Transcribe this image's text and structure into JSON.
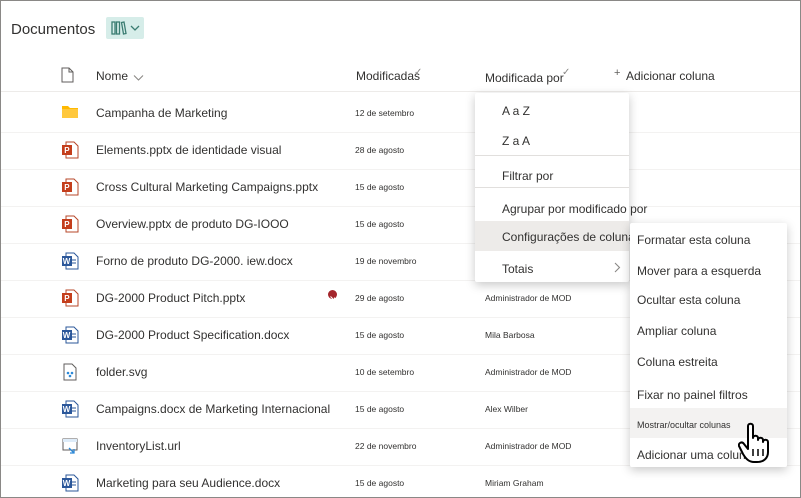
{
  "header": {
    "title": "Documentos"
  },
  "columns": {
    "name": "Nome",
    "modified": "Modificadas",
    "modified_by": "Modificada por",
    "add_column": "Adicionar coluna"
  },
  "files": [
    {
      "type": "folder",
      "icon": "folder-icon",
      "name": "Campanha de Marketing",
      "date": "12 de setembro",
      "by": ""
    },
    {
      "type": "pptx",
      "icon": "powerpoint-icon",
      "name": "Elements.pptx de identidade visual",
      "date": "28 de agosto",
      "by": ""
    },
    {
      "type": "pptx",
      "icon": "powerpoint-icon",
      "name": "Cross Cultural Marketing Campaigns.pptx",
      "date": "15 de agosto",
      "by": ""
    },
    {
      "type": "pptx",
      "icon": "powerpoint-icon",
      "name": "Overview.pptx de produto DG-IOOO",
      "date": "15 de agosto",
      "by": ""
    },
    {
      "type": "docx",
      "icon": "word-icon",
      "name": "Forno de produto DG-2000. iew.docx",
      "date": "19 de novembro",
      "by": ""
    },
    {
      "type": "pptx",
      "icon": "powerpoint-icon",
      "name": "DG-2000 Product Pitch.pptx",
      "date": "29 de agosto",
      "by": "Administrador de MOD",
      "flag": true
    },
    {
      "type": "docx",
      "icon": "word-icon",
      "name": "DG-2000 Product Specification.docx",
      "date": "15 de agosto",
      "by": "Mila Barbosa"
    },
    {
      "type": "svg",
      "icon": "svg-file-icon",
      "name": "folder.svg",
      "date": "10 de setembro",
      "by": "Administrador de MOD"
    },
    {
      "type": "docx",
      "icon": "word-icon",
      "name": "Campaigns.docx de Marketing Internacional",
      "date": "15 de agosto",
      "by": "Alex Wilber"
    },
    {
      "type": "url",
      "icon": "link-file-icon",
      "name": "InventoryList.url",
      "date": "22 de novembro",
      "by": "Administrador de MOD"
    },
    {
      "type": "docx",
      "icon": "word-icon",
      "name": "Marketing para seu Audience.docx",
      "date": "15 de agosto",
      "by": "Miriam Graham"
    }
  ],
  "menu": {
    "items": [
      {
        "label": "A a Z"
      },
      {
        "label": "Z a A"
      },
      {
        "label": "Filtrar por"
      },
      {
        "label": "Agrupar por modificado por"
      },
      {
        "label": "Configurações de coluna",
        "selected": true
      },
      {
        "label": "Totais",
        "submenu": true
      }
    ]
  },
  "submenu": {
    "items": [
      {
        "label": "Formatar esta coluna"
      },
      {
        "label": "Mover para a esquerda"
      },
      {
        "label": "Ocultar esta coluna"
      },
      {
        "label": "Ampliar coluna"
      },
      {
        "label": "Coluna estreita"
      },
      {
        "label": "Fixar no painel filtros"
      },
      {
        "label": "Mostrar/ocultar colunas",
        "hover": true
      },
      {
        "label": "Adicionar uma coluna"
      }
    ]
  },
  "colors": {
    "accent": "#d6ede9",
    "powerpoint": "#c43e1c",
    "word": "#2b579a",
    "folder": "#ffb900",
    "flag": "#a4262c"
  }
}
